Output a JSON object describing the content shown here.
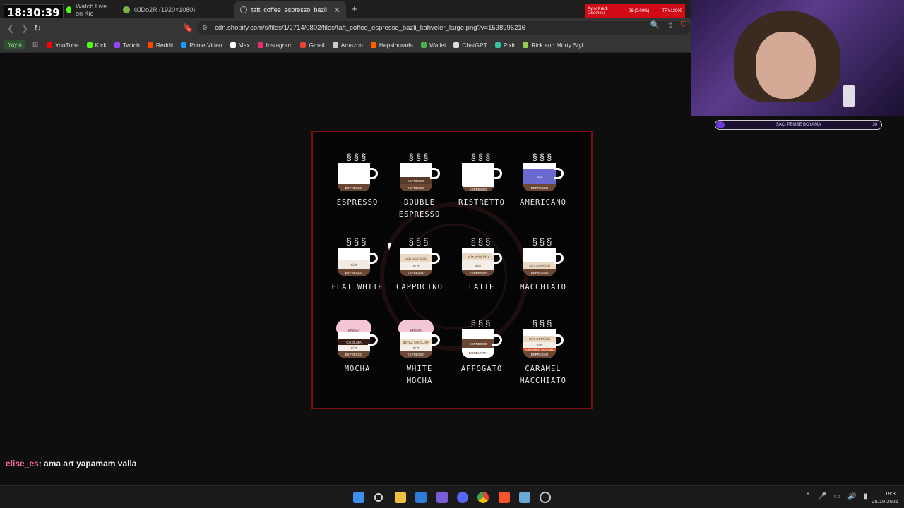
{
  "stream_clock": "18:30:39",
  "tabs": [
    {
      "label": "Watch Live on Kic",
      "color": "#53fc18"
    },
    {
      "label": "0JDo2R (1920×1080)",
      "color": "#7cb342"
    },
    {
      "label": "taft_coffee_espresso_bazli_kahve",
      "color": "#aaaaaa"
    }
  ],
  "url": "cdn.shopify.com/s/files/1/2714/0802/files/taft_coffee_espresso_bazli_kahveler_large.png?v=1538996216",
  "bookmarks": {
    "yayin": "Yayın",
    "items": [
      {
        "label": "YouTube",
        "color": "#ff0000"
      },
      {
        "label": "Kick",
        "color": "#53fc18"
      },
      {
        "label": "Twitch",
        "color": "#9146ff"
      },
      {
        "label": "Reddit",
        "color": "#ff4500"
      },
      {
        "label": "Prime Video",
        "color": "#1a98ff"
      },
      {
        "label": "Max",
        "color": "#ffffff"
      },
      {
        "label": "Instagram",
        "color": "#e1306c"
      },
      {
        "label": "Gmail",
        "color": "#ea4335"
      },
      {
        "label": "Amazon",
        "color": "#cccccc"
      },
      {
        "label": "Hepsiburada",
        "color": "#ff6000"
      },
      {
        "label": "Wallet",
        "color": "#4caf50"
      },
      {
        "label": "ChatGPT",
        "color": "#dddddd"
      },
      {
        "label": "Pixlr",
        "color": "#35c3a8"
      },
      {
        "label": "Rick and Morty Styl...",
        "color": "#97ce4c"
      }
    ]
  },
  "banner": {
    "left": "Aylık Kredi Ödemesi",
    "mid": "06 (0.00%)",
    "right": "TRY12000"
  },
  "progress_bar": {
    "label": "SAÇI PEMBE BOYAMA",
    "count": "30",
    "fraction": 0.03
  },
  "drinks": [
    {
      "name": "ESPRESSO",
      "layers": [
        {
          "text": "ESPRESSO",
          "color": "#6b4632",
          "h": 10
        }
      ]
    },
    {
      "name": "DOUBLE ESPRESSO",
      "layers": [
        {
          "text": "ESPRESSO",
          "color": "#5a3a28",
          "h": 10
        },
        {
          "text": "ESPRESSO",
          "color": "#6b4632",
          "h": 10
        }
      ]
    },
    {
      "name": "RISTRETTO",
      "layers": [
        {
          "text": "ESPRESSO",
          "color": "#6b4632",
          "h": 6
        }
      ]
    },
    {
      "name": "AMERICANO",
      "layers": [
        {
          "text": "SU",
          "color": "#6a6ad0",
          "h": 22
        },
        {
          "text": "ESPRESSO",
          "color": "#6b4632",
          "h": 10
        }
      ]
    },
    {
      "name": "FLAT WHITE",
      "layers": [
        {
          "text": "SÜT",
          "color": "#f0ece4",
          "h": 12,
          "dark": true
        },
        {
          "text": "ESPRESSO",
          "color": "#6b4632",
          "h": 10
        }
      ]
    },
    {
      "name": "CAPPUCINO",
      "layers": [
        {
          "text": "SÜT KÖPÜĞÜ",
          "color": "#e8d8c4",
          "h": 12,
          "dark": true
        },
        {
          "text": "SÜT",
          "color": "#f3efe8",
          "h": 10,
          "dark": true
        },
        {
          "text": "ESPRESSO",
          "color": "#6b4632",
          "h": 9
        }
      ]
    },
    {
      "name": "LATTE",
      "layers": [
        {
          "text": "SÜT KÖPÜĞÜ",
          "color": "#e8d8c4",
          "h": 10,
          "dark": true
        },
        {
          "text": "SÜT",
          "color": "#f3efe8",
          "h": 14,
          "dark": true
        },
        {
          "text": "ESPRESSO",
          "color": "#6b4632",
          "h": 8
        }
      ]
    },
    {
      "name": "MACCHIATO",
      "layers": [
        {
          "text": "SÜT KÖPÜĞÜ",
          "color": "#e8d8c4",
          "h": 10,
          "dark": true
        },
        {
          "text": "ESPRESSO",
          "color": "#6b4632",
          "h": 10
        }
      ]
    },
    {
      "name": "MOCHA",
      "whip": "KREMA",
      "layers": [
        {
          "text": "ÇİKOLATA",
          "color": "#3a1e14",
          "h": 8
        },
        {
          "text": "SÜT",
          "color": "#f3efe8",
          "h": 9,
          "dark": true
        },
        {
          "text": "ESPRESSO",
          "color": "#6b4632",
          "h": 9
        }
      ]
    },
    {
      "name": "WHITE MOCHA",
      "whip": "KREMA",
      "layers": [
        {
          "text": "BEYAZ ÇİKOLATA",
          "color": "#f2e2c8",
          "h": 8,
          "dark": true
        },
        {
          "text": "SÜT",
          "color": "#f3efe8",
          "h": 9,
          "dark": true
        },
        {
          "text": "ESPRESSO",
          "color": "#6b4632",
          "h": 9
        }
      ]
    },
    {
      "name": "AFFOGATO",
      "layers": [
        {
          "text": "ESPRESSO",
          "color": "#6b4632",
          "h": 12
        },
        {
          "text": "DONDURMA",
          "color": "#ffffff",
          "h": 14,
          "dark": true
        }
      ]
    },
    {
      "name": "CARAMEL MACCHIATO",
      "layers": [
        {
          "text": "SÜT KÖPÜĞÜ",
          "color": "#e8d8c4",
          "h": 9,
          "dark": true
        },
        {
          "text": "SÜT",
          "color": "#f3efe8",
          "h": 8,
          "dark": true
        },
        {
          "text": "KARAMEL ŞURUBU",
          "color": "#d4552a",
          "h": 5
        },
        {
          "text": "ESPRESSO",
          "color": "#6b4632",
          "h": 9
        }
      ]
    }
  ],
  "chat": {
    "user": "elise_es",
    "message": ": ama art yapamam valla"
  },
  "taskbar": {
    "time": "18:30",
    "date": "25.10.2025"
  }
}
